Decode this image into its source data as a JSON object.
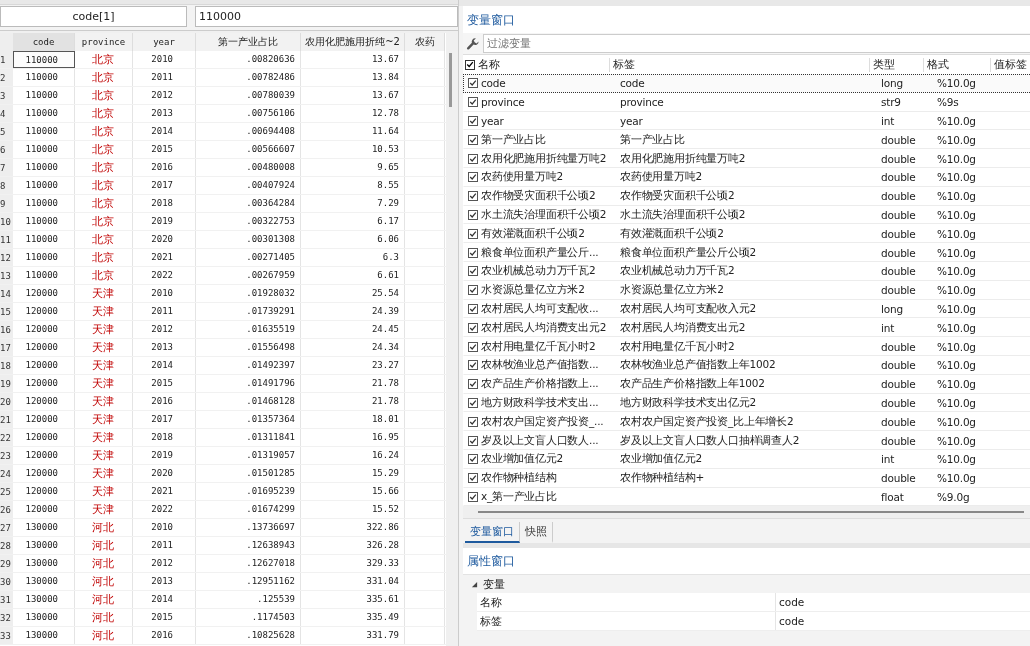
{
  "cell_bar": {
    "reference": "code[1]",
    "value": "110000"
  },
  "data_editor": {
    "columns": [
      {
        "label": "code",
        "kind": "numeric"
      },
      {
        "label": "province",
        "kind": "string"
      },
      {
        "label": "year",
        "kind": "numeric"
      },
      {
        "label": "第一产业占比",
        "kind": "numeric"
      },
      {
        "label": "农用化肥施用折纯~2",
        "kind": "numeric"
      },
      {
        "label": "农药",
        "kind": "numeric"
      }
    ],
    "rows": [
      {
        "number": "1",
        "selected": true,
        "cells": [
          "110000",
          "北京",
          "2010",
          ".00820636",
          "13.67"
        ]
      },
      {
        "number": "2",
        "selected": false,
        "cells": [
          "110000",
          "北京",
          "2011",
          ".00782486",
          "13.84"
        ]
      },
      {
        "number": "3",
        "selected": false,
        "cells": [
          "110000",
          "北京",
          "2012",
          ".00780039",
          "13.67"
        ]
      },
      {
        "number": "4",
        "selected": false,
        "cells": [
          "110000",
          "北京",
          "2013",
          ".00756106",
          "12.78"
        ]
      },
      {
        "number": "5",
        "selected": false,
        "cells": [
          "110000",
          "北京",
          "2014",
          ".00694408",
          "11.64"
        ]
      },
      {
        "number": "6",
        "selected": false,
        "cells": [
          "110000",
          "北京",
          "2015",
          ".00566607",
          "10.53"
        ]
      },
      {
        "number": "7",
        "selected": false,
        "cells": [
          "110000",
          "北京",
          "2016",
          ".00480008",
          "9.65"
        ]
      },
      {
        "number": "8",
        "selected": false,
        "cells": [
          "110000",
          "北京",
          "2017",
          ".00407924",
          "8.55"
        ]
      },
      {
        "number": "9",
        "selected": false,
        "cells": [
          "110000",
          "北京",
          "2018",
          ".00364284",
          "7.29"
        ]
      },
      {
        "number": "10",
        "selected": false,
        "cells": [
          "110000",
          "北京",
          "2019",
          ".00322753",
          "6.17"
        ]
      },
      {
        "number": "11",
        "selected": false,
        "cells": [
          "110000",
          "北京",
          "2020",
          ".00301308",
          "6.06"
        ]
      },
      {
        "number": "12",
        "selected": false,
        "cells": [
          "110000",
          "北京",
          "2021",
          ".00271405",
          "6.3"
        ]
      },
      {
        "number": "13",
        "selected": false,
        "cells": [
          "110000",
          "北京",
          "2022",
          ".00267959",
          "6.61"
        ]
      },
      {
        "number": "14",
        "selected": false,
        "cells": [
          "120000",
          "天津",
          "2010",
          ".01928032",
          "25.54"
        ]
      },
      {
        "number": "15",
        "selected": false,
        "cells": [
          "120000",
          "天津",
          "2011",
          ".01739291",
          "24.39"
        ]
      },
      {
        "number": "16",
        "selected": false,
        "cells": [
          "120000",
          "天津",
          "2012",
          ".01635519",
          "24.45"
        ]
      },
      {
        "number": "17",
        "selected": false,
        "cells": [
          "120000",
          "天津",
          "2013",
          ".01556498",
          "24.34"
        ]
      },
      {
        "number": "18",
        "selected": false,
        "cells": [
          "120000",
          "天津",
          "2014",
          ".01492397",
          "23.27"
        ]
      },
      {
        "number": "19",
        "selected": false,
        "cells": [
          "120000",
          "天津",
          "2015",
          ".01491796",
          "21.78"
        ]
      },
      {
        "number": "20",
        "selected": false,
        "cells": [
          "120000",
          "天津",
          "2016",
          ".01468128",
          "21.78"
        ]
      },
      {
        "number": "21",
        "selected": false,
        "cells": [
          "120000",
          "天津",
          "2017",
          ".01357364",
          "18.01"
        ]
      },
      {
        "number": "22",
        "selected": false,
        "cells": [
          "120000",
          "天津",
          "2018",
          ".01311841",
          "16.95"
        ]
      },
      {
        "number": "23",
        "selected": false,
        "cells": [
          "120000",
          "天津",
          "2019",
          ".01319057",
          "16.24"
        ]
      },
      {
        "number": "24",
        "selected": false,
        "cells": [
          "120000",
          "天津",
          "2020",
          ".01501285",
          "15.29"
        ]
      },
      {
        "number": "25",
        "selected": false,
        "cells": [
          "120000",
          "天津",
          "2021",
          ".01695239",
          "15.66"
        ]
      },
      {
        "number": "26",
        "selected": false,
        "cells": [
          "120000",
          "天津",
          "2022",
          ".01674299",
          "15.52"
        ]
      },
      {
        "number": "27",
        "selected": false,
        "cells": [
          "130000",
          "河北",
          "2010",
          ".13736697",
          "322.86"
        ]
      },
      {
        "number": "28",
        "selected": false,
        "cells": [
          "130000",
          "河北",
          "2011",
          ".12638943",
          "326.28"
        ]
      },
      {
        "number": "29",
        "selected": false,
        "cells": [
          "130000",
          "河北",
          "2012",
          ".12627018",
          "329.33"
        ]
      },
      {
        "number": "30",
        "selected": false,
        "cells": [
          "130000",
          "河北",
          "2013",
          ".12951162",
          "331.04"
        ]
      },
      {
        "number": "31",
        "selected": false,
        "cells": [
          "130000",
          "河北",
          "2014",
          ".125539",
          "335.61"
        ]
      },
      {
        "number": "32",
        "selected": false,
        "cells": [
          "130000",
          "河北",
          "2015",
          ".1174503",
          "335.49"
        ]
      },
      {
        "number": "33",
        "selected": false,
        "cells": [
          "130000",
          "河北",
          "2016",
          ".10825628",
          "331.79"
        ]
      }
    ]
  },
  "variables_window": {
    "title": "变量窗口",
    "filter": {
      "placeholder": "过滤变量"
    },
    "header": {
      "checked": true,
      "columns": [
        "名称",
        "标签",
        "类型",
        "格式",
        "值标签"
      ]
    },
    "variables": [
      {
        "name": "code",
        "label": "code",
        "type": "long",
        "format": "%10.0g",
        "checked": true,
        "selected": true
      },
      {
        "name": "province",
        "label": "province",
        "type": "str9",
        "format": "%9s",
        "checked": true,
        "selected": false
      },
      {
        "name": "year",
        "label": "year",
        "type": "int",
        "format": "%10.0g",
        "checked": true,
        "selected": false
      },
      {
        "name": "第一产业占比",
        "label": "第一产业占比",
        "type": "double",
        "format": "%10.0g",
        "checked": true,
        "selected": false
      },
      {
        "name": "农用化肥施用折纯量万吨2",
        "label": "农用化肥施用折纯量万吨2",
        "type": "double",
        "format": "%10.0g",
        "checked": true,
        "selected": false
      },
      {
        "name": "农药使用量万吨2",
        "label": "农药使用量万吨2",
        "type": "double",
        "format": "%10.0g",
        "checked": true,
        "selected": false
      },
      {
        "name": "农作物受灾面积千公顷2",
        "label": "农作物受灾面积千公顷2",
        "type": "double",
        "format": "%10.0g",
        "checked": true,
        "selected": false
      },
      {
        "name": "水土流失治理面积千公顷2",
        "label": "水土流失治理面积千公顷2",
        "type": "double",
        "format": "%10.0g",
        "checked": true,
        "selected": false
      },
      {
        "name": "有效灌溉面积千公顷2",
        "label": "有效灌溉面积千公顷2",
        "type": "double",
        "format": "%10.0g",
        "checked": true,
        "selected": false
      },
      {
        "name": "粮食单位面积产量公斤...",
        "label": "粮食单位面积产量公斤公顷2",
        "type": "double",
        "format": "%10.0g",
        "checked": true,
        "selected": false
      },
      {
        "name": "农业机械总动力万千瓦2",
        "label": "农业机械总动力万千瓦2",
        "type": "double",
        "format": "%10.0g",
        "checked": true,
        "selected": false
      },
      {
        "name": "水资源总量亿立方米2",
        "label": "水资源总量亿立方米2",
        "type": "double",
        "format": "%10.0g",
        "checked": true,
        "selected": false
      },
      {
        "name": "农村居民人均可支配收...",
        "label": "农村居民人均可支配收入元2",
        "type": "long",
        "format": "%10.0g",
        "checked": true,
        "selected": false
      },
      {
        "name": "农村居民人均消费支出元2",
        "label": "农村居民人均消费支出元2",
        "type": "int",
        "format": "%10.0g",
        "checked": true,
        "selected": false
      },
      {
        "name": "农村用电量亿千瓦小时2",
        "label": "农村用电量亿千瓦小时2",
        "type": "double",
        "format": "%10.0g",
        "checked": true,
        "selected": false
      },
      {
        "name": "农林牧渔业总产值指数...",
        "label": "农林牧渔业总产值指数上年1002",
        "type": "double",
        "format": "%10.0g",
        "checked": true,
        "selected": false
      },
      {
        "name": "农产品生产价格指数上...",
        "label": "农产品生产价格指数上年1002",
        "type": "double",
        "format": "%10.0g",
        "checked": true,
        "selected": false
      },
      {
        "name": "地方财政科学技术支出...",
        "label": "地方财政科学技术支出亿元2",
        "type": "double",
        "format": "%10.0g",
        "checked": true,
        "selected": false
      },
      {
        "name": "农村农户国定资产投资_...",
        "label": "农村农户国定资产投资_比上年增长2",
        "type": "double",
        "format": "%10.0g",
        "checked": true,
        "selected": false
      },
      {
        "name": "岁及以上文盲人口数人...",
        "label": "岁及以上文盲人口数人口抽样调查人2",
        "type": "double",
        "format": "%10.0g",
        "checked": true,
        "selected": false
      },
      {
        "name": "农业增加值亿元2",
        "label": "农业增加值亿元2",
        "type": "int",
        "format": "%10.0g",
        "checked": true,
        "selected": false
      },
      {
        "name": "农作物种植结构",
        "label": "农作物种植结构+",
        "type": "double",
        "format": "%10.0g",
        "checked": true,
        "selected": false
      },
      {
        "name": "x_第一产业占比",
        "type": "float",
        "format": "%9.0g",
        "checked": true,
        "selected": false
      }
    ]
  },
  "tabs": [
    {
      "label": "变量窗口",
      "selected": true
    },
    {
      "label": "快照",
      "selected": false
    }
  ],
  "properties_window": {
    "title": "属性窗口",
    "groups": [
      {
        "label": "变量",
        "expanded": true,
        "properties": [
          {
            "name": "名称",
            "value": "code"
          },
          {
            "name": "标签",
            "value": "code"
          }
        ]
      }
    ]
  }
}
